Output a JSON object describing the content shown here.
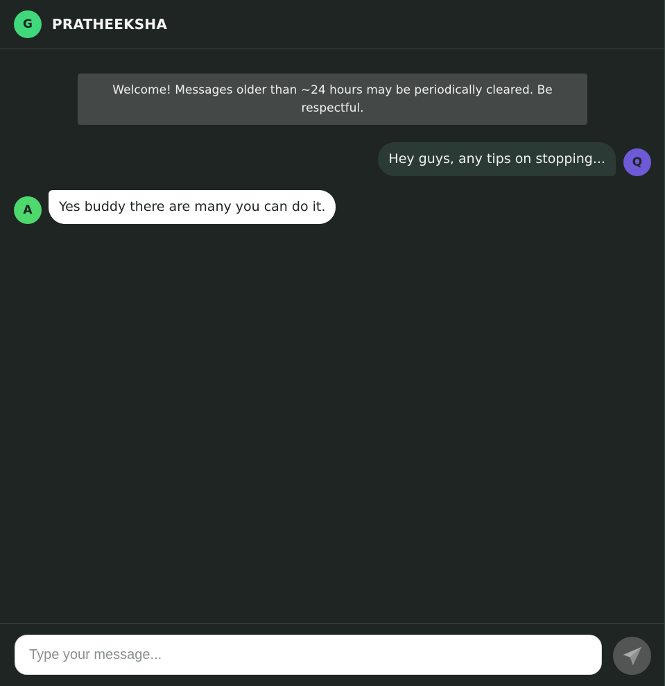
{
  "header": {
    "avatar_initial": "G",
    "avatar_color": "#3fd97c",
    "title": "PRATHEEKSHA"
  },
  "notice": {
    "text": "Welcome! Messages older than ~24 hours may be periodically cleared. Be respectful."
  },
  "messages": [
    {
      "direction": "outgoing",
      "avatar_initial": "Q",
      "avatar_color": "#6e5ad6",
      "text": "Hey guys, any tips on stopping..."
    },
    {
      "direction": "incoming",
      "avatar_initial": "A",
      "avatar_color": "#4ed86e",
      "text": "Yes buddy there are many you can do it."
    }
  ],
  "composer": {
    "placeholder": "Type your message...",
    "value": "",
    "send_icon": "send-icon"
  }
}
